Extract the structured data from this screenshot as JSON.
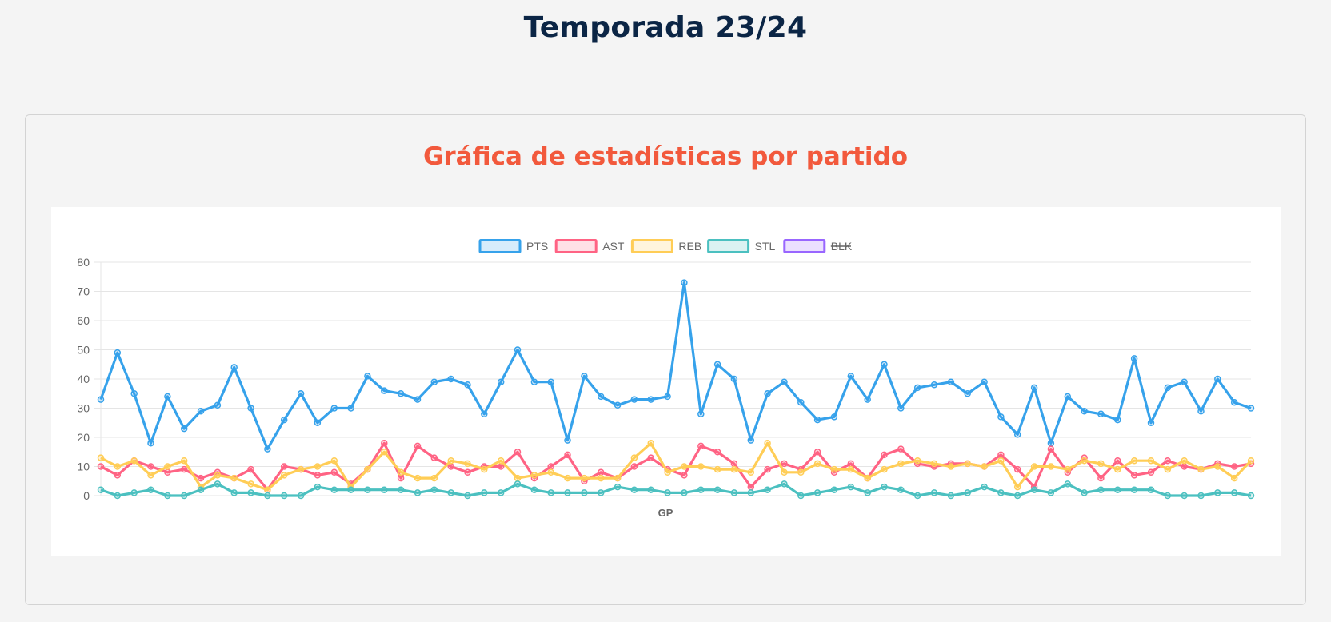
{
  "page": {
    "title": "Temporada 23/24"
  },
  "card": {
    "title": "Gráfica de estadísticas por partido"
  },
  "chart_data": {
    "type": "line",
    "xlabel": "GP",
    "ylabel": "",
    "ylim": [
      0,
      80
    ],
    "yticks": [
      0,
      10,
      20,
      30,
      40,
      50,
      60,
      70,
      80
    ],
    "x_tick_labels_shown": false,
    "grid": true,
    "legend_position": "top",
    "series": [
      {
        "name": "PTS",
        "color": "#36a2eb",
        "fill": "rgba(54,162,235,0.2)",
        "hidden": false,
        "values": [
          33,
          49,
          35,
          18,
          34,
          23,
          29,
          31,
          44,
          30,
          16,
          26,
          35,
          25,
          30,
          30,
          41,
          36,
          35,
          33,
          39,
          40,
          38,
          28,
          39,
          50,
          39,
          39,
          19,
          41,
          34,
          31,
          33,
          33,
          34,
          73,
          28,
          45,
          40,
          19,
          35,
          39,
          32,
          26,
          27,
          41,
          33,
          45,
          30,
          37,
          38,
          39,
          35,
          39,
          27,
          21,
          37,
          18,
          34,
          29,
          28,
          26,
          47,
          25,
          37,
          39,
          29,
          40,
          32,
          30
        ]
      },
      {
        "name": "AST",
        "color": "#ff6384",
        "fill": "rgba(255,99,132,0.2)",
        "hidden": false,
        "values": [
          10,
          7,
          12,
          10,
          8,
          9,
          6,
          8,
          6,
          9,
          2,
          10,
          9,
          7,
          8,
          4,
          9,
          18,
          6,
          17,
          13,
          10,
          8,
          10,
          10,
          15,
          6,
          10,
          14,
          5,
          8,
          6,
          10,
          13,
          9,
          7,
          17,
          15,
          11,
          3,
          9,
          11,
          9,
          15,
          8,
          11,
          6,
          14,
          16,
          11,
          10,
          11,
          11,
          10,
          14,
          9,
          3,
          16,
          8,
          13,
          6,
          12,
          7,
          8,
          12,
          10,
          9,
          11,
          10,
          11
        ]
      },
      {
        "name": "REB",
        "color": "#ffcd56",
        "fill": "rgba(255,205,86,0.2)",
        "hidden": false,
        "values": [
          13,
          10,
          12,
          7,
          10,
          12,
          3,
          7,
          6,
          4,
          2,
          7,
          9,
          10,
          12,
          3,
          9,
          15,
          8,
          6,
          6,
          12,
          11,
          9,
          12,
          6,
          7,
          8,
          6,
          6,
          6,
          6,
          13,
          18,
          8,
          10,
          10,
          9,
          9,
          8,
          18,
          8,
          8,
          11,
          9,
          9,
          6,
          9,
          11,
          12,
          11,
          10,
          11,
          10,
          12,
          3,
          10,
          10,
          9,
          12,
          11,
          9,
          12,
          12,
          9,
          12,
          9,
          10,
          6,
          12
        ]
      },
      {
        "name": "STL",
        "color": "#4bc0c0",
        "fill": "rgba(75,192,192,0.2)",
        "hidden": false,
        "values": [
          2,
          0,
          1,
          2,
          0,
          0,
          2,
          4,
          1,
          1,
          0,
          0,
          0,
          3,
          2,
          2,
          2,
          2,
          2,
          1,
          2,
          1,
          0,
          1,
          1,
          4,
          2,
          1,
          1,
          1,
          1,
          3,
          2,
          2,
          1,
          1,
          2,
          2,
          1,
          1,
          2,
          4,
          0,
          1,
          2,
          3,
          1,
          3,
          2,
          0,
          1,
          0,
          1,
          3,
          1,
          0,
          2,
          1,
          4,
          1,
          2,
          2,
          2,
          2,
          0,
          0,
          0,
          1,
          1,
          0
        ]
      },
      {
        "name": "BLK",
        "color": "#9966ff",
        "fill": "rgba(153,102,255,0.2)",
        "hidden": true,
        "values": []
      }
    ]
  }
}
